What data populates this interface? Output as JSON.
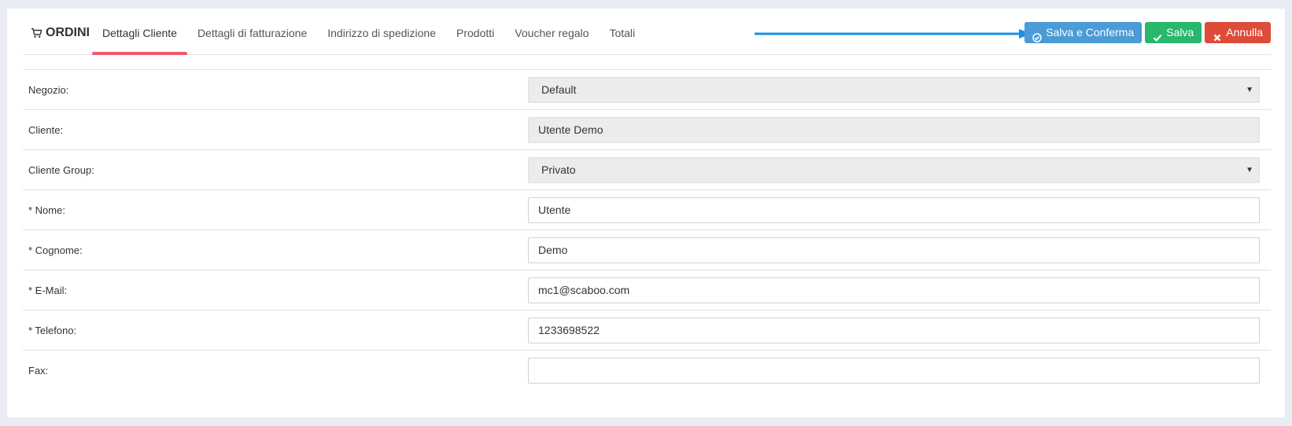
{
  "header": {
    "brand": "ORDINI",
    "tabs": [
      {
        "label": "Dettagli Cliente",
        "active": true
      },
      {
        "label": "Dettagli di fatturazione"
      },
      {
        "label": "Indirizzo di spedizione"
      },
      {
        "label": "Prodotti"
      },
      {
        "label": "Voucher regalo"
      },
      {
        "label": "Totali"
      }
    ],
    "actions": {
      "save_confirm": "Salva e Conferma",
      "save": "Salva",
      "cancel": "Annulla"
    }
  },
  "form": {
    "store_label": "Negozio:",
    "store_value": "Default",
    "customer_label": "Cliente:",
    "customer_value": "Utente Demo",
    "group_label": "Cliente Group:",
    "group_value": "Privato",
    "firstname_label": "* Nome:",
    "firstname_value": "Utente",
    "lastname_label": "* Cognome:",
    "lastname_value": "Demo",
    "email_label": "* E-Mail:",
    "email_value": "mc1@scaboo.com",
    "phone_label": "* Telefono:",
    "phone_value": "1233698522",
    "fax_label": "Fax:",
    "fax_value": ""
  },
  "colors": {
    "accent_tab": "#f05a6a",
    "btn_blue": "#4a9bd6",
    "btn_green": "#27b86c",
    "btn_red": "#dd4b39",
    "arrow": "#1a8fe3"
  },
  "icons": {
    "brand": "shopping-cart-icon",
    "save_confirm": "check-circle-icon",
    "save": "check-icon",
    "cancel": "times-icon",
    "select": "caret-down-icon"
  }
}
